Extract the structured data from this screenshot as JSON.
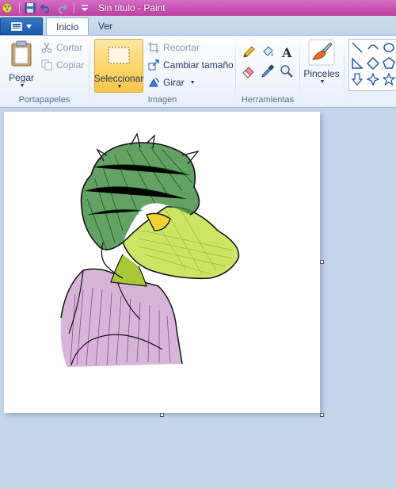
{
  "window": {
    "title": "Sin título - Paint"
  },
  "quick_access": {
    "icons": [
      "paint-app-icon",
      "save-icon",
      "undo-icon",
      "redo-icon",
      "customize-dropdown-icon"
    ]
  },
  "tabs": [
    {
      "label": "Inicio",
      "active": true
    },
    {
      "label": "Ver",
      "active": false
    }
  ],
  "ribbon": {
    "clipboard": {
      "label": "Portapapeles",
      "paste": "Pegar",
      "cut": "Cortar",
      "copy": "Copiar"
    },
    "image": {
      "label": "Imagen",
      "select": "Seleccionar",
      "crop": "Recortar",
      "resize": "Cambiar tamaño",
      "rotate": "Girar"
    },
    "tools": {
      "label": "Herramientas",
      "items": [
        "pencil-icon",
        "fill-icon",
        "text-icon",
        "eraser-icon",
        "color-picker-icon",
        "magnifier-icon"
      ]
    },
    "brushes": {
      "label": "Pinceles"
    },
    "shapes": {
      "items": [
        "line-icon",
        "curve-icon",
        "oval-icon",
        "triangle-icon",
        "diamond-icon",
        "pentagon-icon",
        "arrow-down-icon",
        "star4-icon",
        "star5-icon"
      ]
    }
  },
  "colors": {
    "titlebar": "#c94fb5",
    "select_highlight": "#fbd66d",
    "workspace": "#c5d6ec",
    "drawing_green": "#1e6a2a",
    "drawing_lime": "#c4e04a",
    "drawing_purple": "#8a2a8e"
  }
}
